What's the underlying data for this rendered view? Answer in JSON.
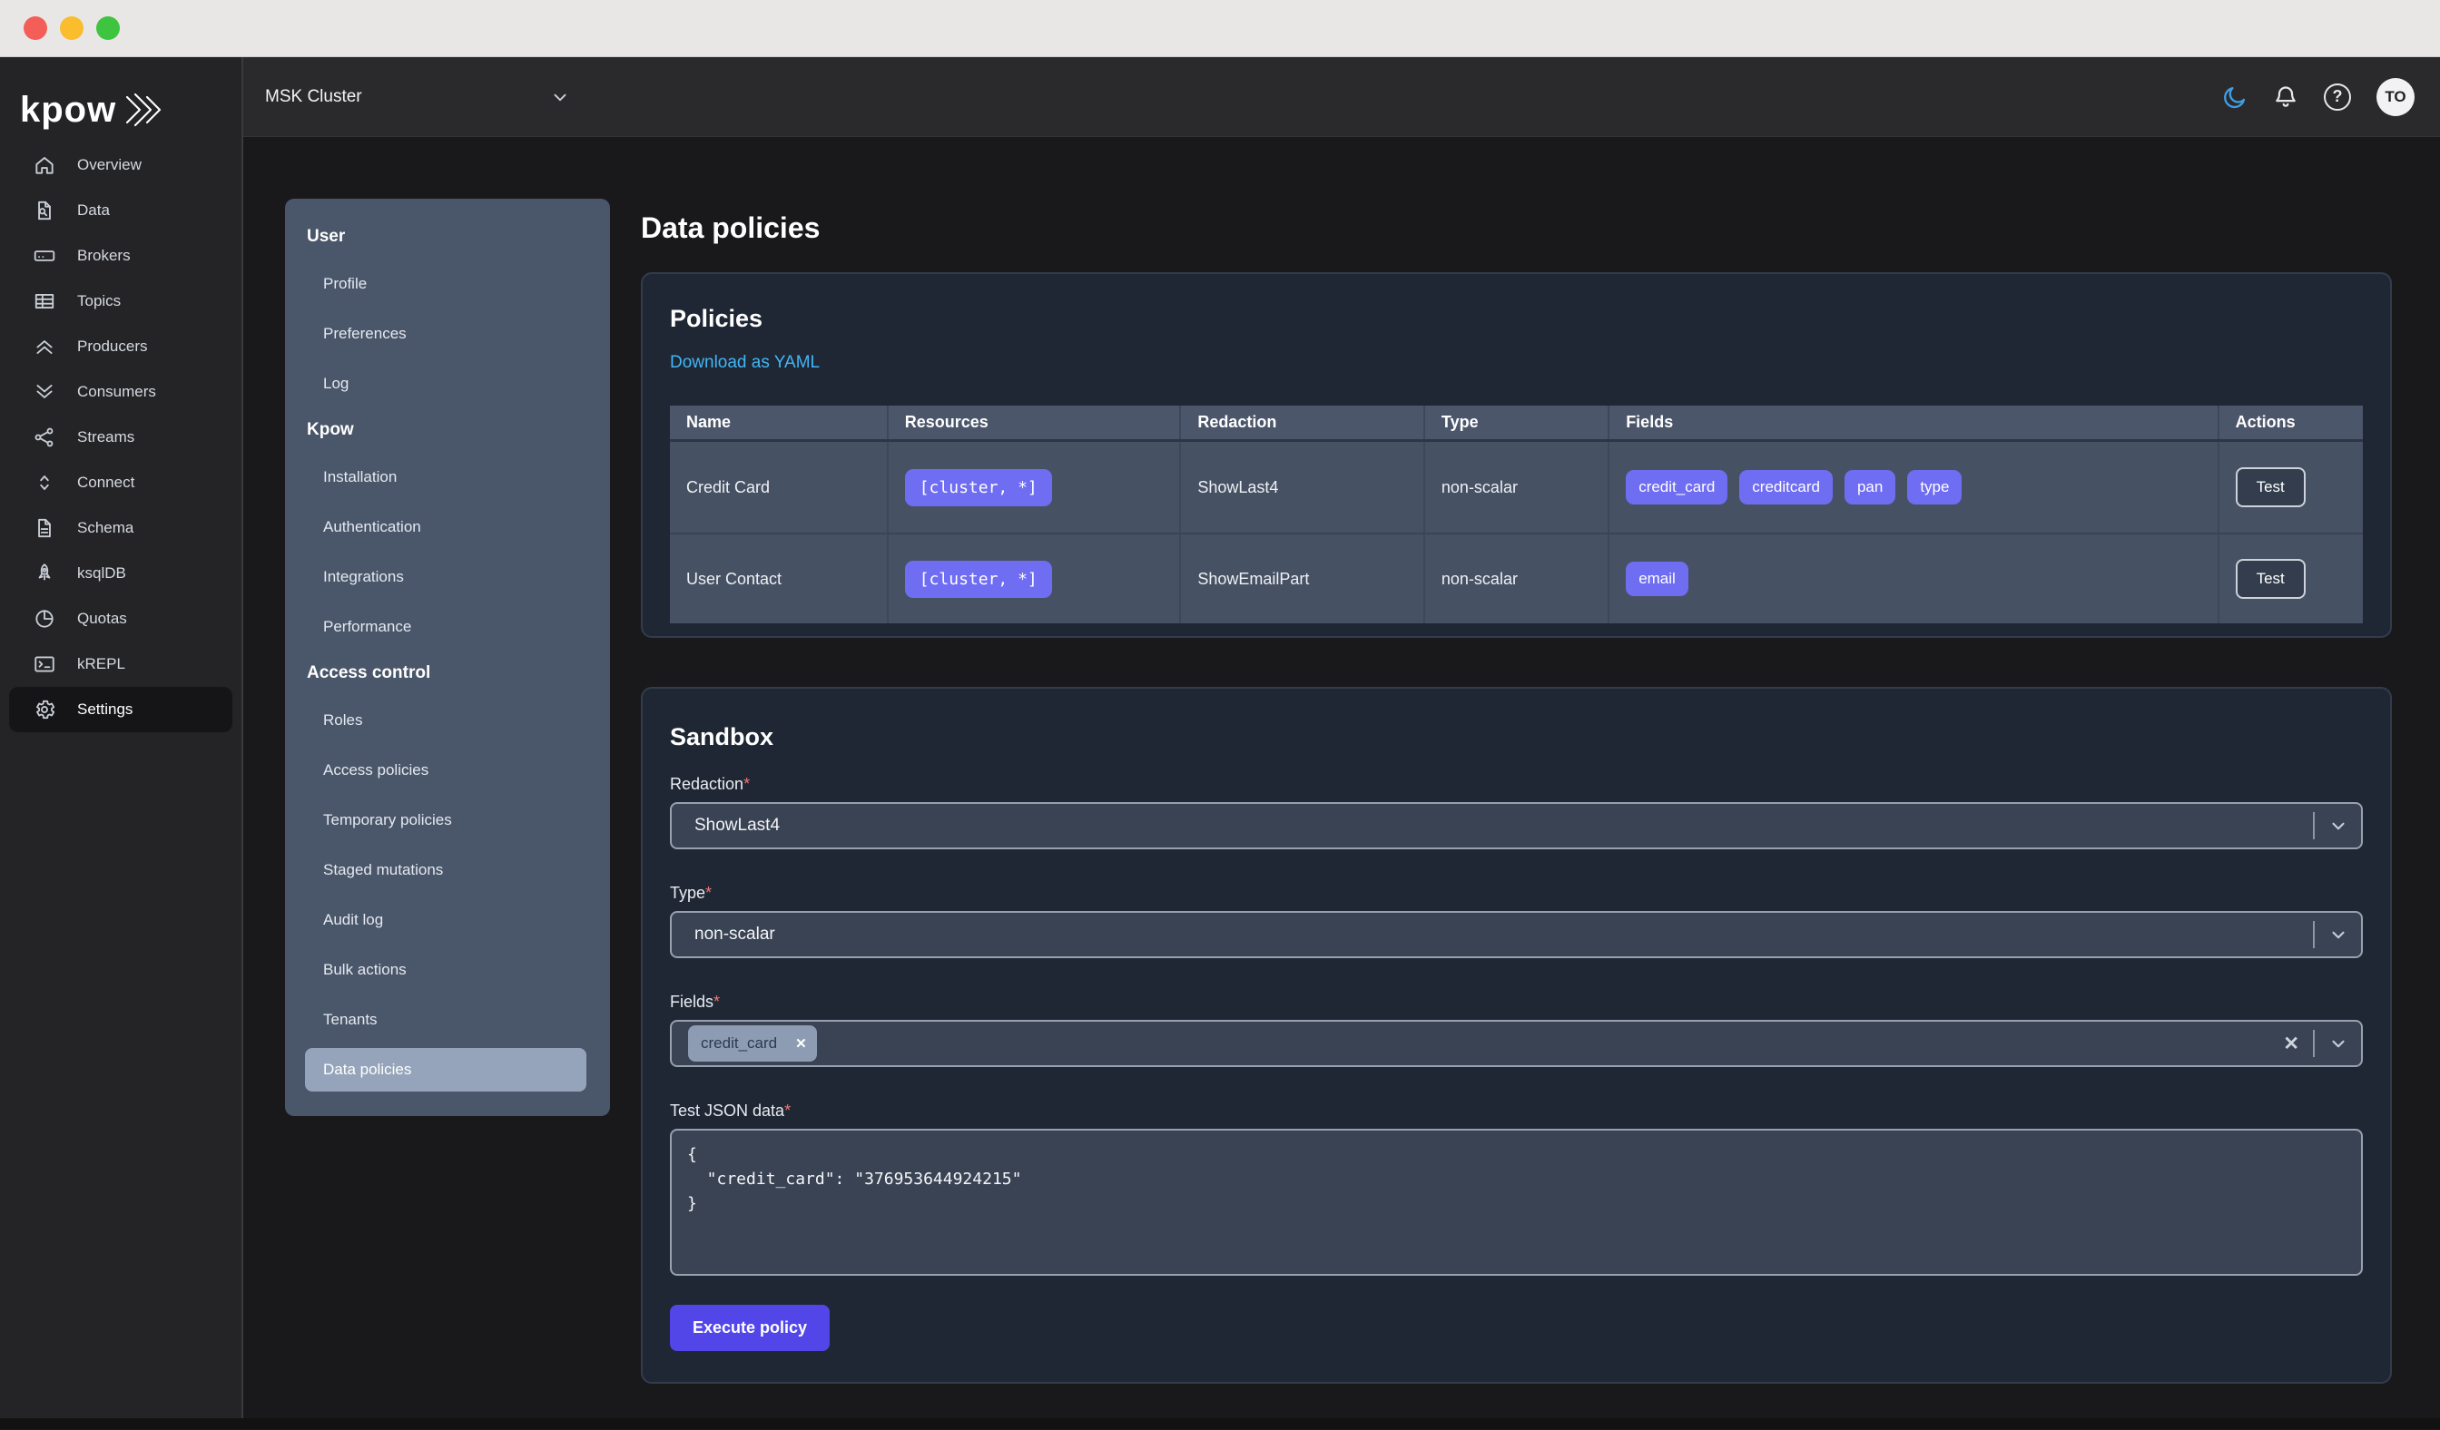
{
  "colors": {
    "accent_purple": "#6f6df2",
    "button_purple": "#5346e8",
    "link_blue": "#41b6f7",
    "moon_blue": "#3f9ee4",
    "panel_slate": "#4a5669",
    "card_navy": "#1f2734",
    "traffic_red": "#f35f58",
    "traffic_yellow": "#f9bd2e",
    "traffic_green": "#3ec43f"
  },
  "topbar": {
    "cluster_selector": {
      "value": "MSK Cluster",
      "icon": "chevron-down-icon"
    },
    "icons": [
      {
        "name": "moon-icon"
      },
      {
        "name": "bell-icon"
      },
      {
        "name": "help-icon",
        "glyph": "?"
      }
    ],
    "avatar_initials": "TO"
  },
  "sidebar": {
    "logo_text": "kpow",
    "logo_icon": "double-chevron-logo-icon",
    "items": [
      {
        "label": "Overview",
        "icon": "home-icon",
        "active": false
      },
      {
        "label": "Data",
        "icon": "document-search-icon",
        "active": false
      },
      {
        "label": "Brokers",
        "icon": "server-icon",
        "active": false
      },
      {
        "label": "Topics",
        "icon": "table-icon",
        "active": false
      },
      {
        "label": "Producers",
        "icon": "chevrons-up-icon",
        "active": false
      },
      {
        "label": "Consumers",
        "icon": "chevrons-down-icon",
        "active": false
      },
      {
        "label": "Streams",
        "icon": "share-icon",
        "active": false
      },
      {
        "label": "Connect",
        "icon": "sort-icon",
        "active": false
      },
      {
        "label": "Schema",
        "icon": "document-icon",
        "active": false
      },
      {
        "label": "ksqlDB",
        "icon": "rocket-icon",
        "active": false
      },
      {
        "label": "Quotas",
        "icon": "pie-chart-icon",
        "active": false
      },
      {
        "label": "kREPL",
        "icon": "terminal-icon",
        "active": false
      },
      {
        "label": "Settings",
        "icon": "gear-icon",
        "active": true
      }
    ]
  },
  "subnav": {
    "sections": [
      {
        "label": "User",
        "items": [
          {
            "label": "Profile",
            "active": false
          },
          {
            "label": "Preferences",
            "active": false
          },
          {
            "label": "Log",
            "active": false
          }
        ]
      },
      {
        "label": "Kpow",
        "items": [
          {
            "label": "Installation",
            "active": false
          },
          {
            "label": "Authentication",
            "active": false
          },
          {
            "label": "Integrations",
            "active": false
          },
          {
            "label": "Performance",
            "active": false
          }
        ]
      },
      {
        "label": "Access control",
        "items": [
          {
            "label": "Roles",
            "active": false
          },
          {
            "label": "Access policies",
            "active": false
          },
          {
            "label": "Temporary policies",
            "active": false
          },
          {
            "label": "Staged mutations",
            "active": false
          },
          {
            "label": "Audit log",
            "active": false
          },
          {
            "label": "Bulk actions",
            "active": false
          },
          {
            "label": "Tenants",
            "active": false
          },
          {
            "label": "Data policies",
            "active": true
          }
        ]
      }
    ]
  },
  "page": {
    "title": "Data policies"
  },
  "policies_card": {
    "title": "Policies",
    "download_link": "Download as YAML",
    "table": {
      "headers": [
        "Name",
        "Resources",
        "Redaction",
        "Type",
        "Fields",
        "Actions"
      ],
      "rows": [
        {
          "name": "Credit Card",
          "resources": "[cluster, *]",
          "redaction": "ShowLast4",
          "type": "non-scalar",
          "fields": [
            "credit_card",
            "creditcard",
            "pan",
            "type"
          ],
          "action": "Test"
        },
        {
          "name": "User Contact",
          "resources": "[cluster, *]",
          "redaction": "ShowEmailPart",
          "type": "non-scalar",
          "fields": [
            "email"
          ],
          "action": "Test"
        }
      ]
    }
  },
  "sandbox": {
    "title": "Sandbox",
    "required_marker": "*",
    "redaction": {
      "label": "Redaction",
      "value": "ShowLast4"
    },
    "type": {
      "label": "Type",
      "value": "non-scalar"
    },
    "fields": {
      "label": "Fields",
      "chips": [
        "credit_card"
      ],
      "clear_glyph": "✕",
      "chip_remove_glyph": "✕"
    },
    "test_json": {
      "label": "Test JSON data",
      "value": "{\n  \"credit_card\": \"376953644924215\"\n}"
    },
    "execute_label": "Execute policy"
  }
}
